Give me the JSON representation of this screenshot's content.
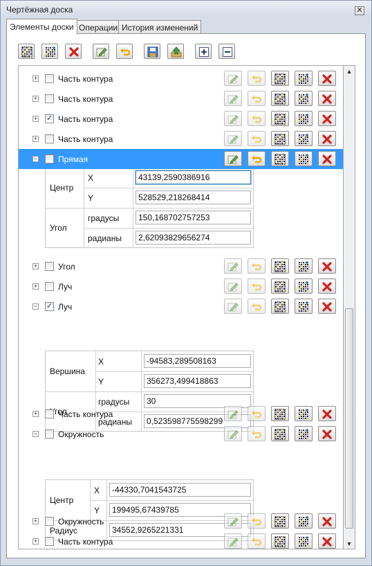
{
  "window": {
    "title": "Чертёжная доска",
    "close_glyph": "✕"
  },
  "tabs": [
    {
      "label": "Элементы доски",
      "active": true
    },
    {
      "label": "Операции",
      "active": false
    },
    {
      "label": "История изменений",
      "active": false
    }
  ],
  "toolbar": {
    "buttons": [
      {
        "name": "select-all-button",
        "icon": "grid-select-icon"
      },
      {
        "name": "invert-selection-button",
        "icon": "grid-add-icon"
      },
      {
        "name": "delete-selected-button",
        "icon": "red-x-icon"
      },
      {
        "name": "edit-button",
        "icon": "pencil-icon"
      },
      {
        "name": "undo-button",
        "icon": "undo-arrow-icon"
      },
      {
        "name": "save-button",
        "icon": "save-icon"
      },
      {
        "name": "load-button",
        "icon": "open-icon"
      },
      {
        "name": "expand-all-button",
        "icon": "plus-box-icon"
      },
      {
        "name": "collapse-all-button",
        "icon": "minus-box-icon"
      }
    ]
  },
  "items": [
    {
      "label": "Часть контура",
      "checked": false,
      "expanded": false,
      "selected": false
    },
    {
      "label": "Часть контура",
      "checked": false,
      "expanded": false,
      "selected": false
    },
    {
      "label": "Часть контура",
      "checked": true,
      "expanded": false,
      "selected": false
    },
    {
      "label": "Часть контура",
      "checked": false,
      "expanded": false,
      "selected": false
    },
    {
      "label": "Прямая",
      "checked": false,
      "expanded": true,
      "selected": true
    },
    {
      "label": "Угол",
      "checked": false,
      "expanded": false,
      "selected": false
    },
    {
      "label": "Луч",
      "checked": false,
      "expanded": false,
      "selected": false
    },
    {
      "label": "Луч",
      "checked": true,
      "expanded": true,
      "selected": false
    },
    {
      "label": "Часть контура",
      "checked": false,
      "expanded": false,
      "selected": false
    },
    {
      "label": "Окружность",
      "checked": false,
      "expanded": true,
      "selected": false
    },
    {
      "label": "Окружность",
      "checked": false,
      "expanded": false,
      "selected": false
    },
    {
      "label": "Часть контура",
      "checked": false,
      "expanded": false,
      "selected": false
    }
  ],
  "line_props": {
    "center_label": "Центр",
    "x_label": "X",
    "y_label": "Y",
    "x_value": "43139,2590386916",
    "y_value": "528529,218268414",
    "angle_label": "Угол",
    "deg_label": "градусы",
    "rad_label": "радианы",
    "deg_value": "150,168702757253",
    "rad_value": "2,62093829656274"
  },
  "ray_props": {
    "vertex_label": "Вершина",
    "x_label": "X",
    "y_label": "Y",
    "x_value": "-94583,289508163",
    "y_value": "356273,499418863",
    "angle_label": "Угол",
    "deg_label": "градусы",
    "rad_label": "радианы",
    "deg_value": "30",
    "rad_value": "0,523598775598299"
  },
  "circle_props": {
    "center_label": "Центр",
    "x_label": "X",
    "y_label": "Y",
    "x_value": "-44330,7041543725",
    "y_value": "199495,67439785",
    "radius_label": "Радиус",
    "radius_value": "34552,9265221331"
  },
  "glyphs": {
    "expand": "+",
    "collapse": "−",
    "check": "✓",
    "scroll_up": "▲",
    "scroll_down": "▼"
  }
}
